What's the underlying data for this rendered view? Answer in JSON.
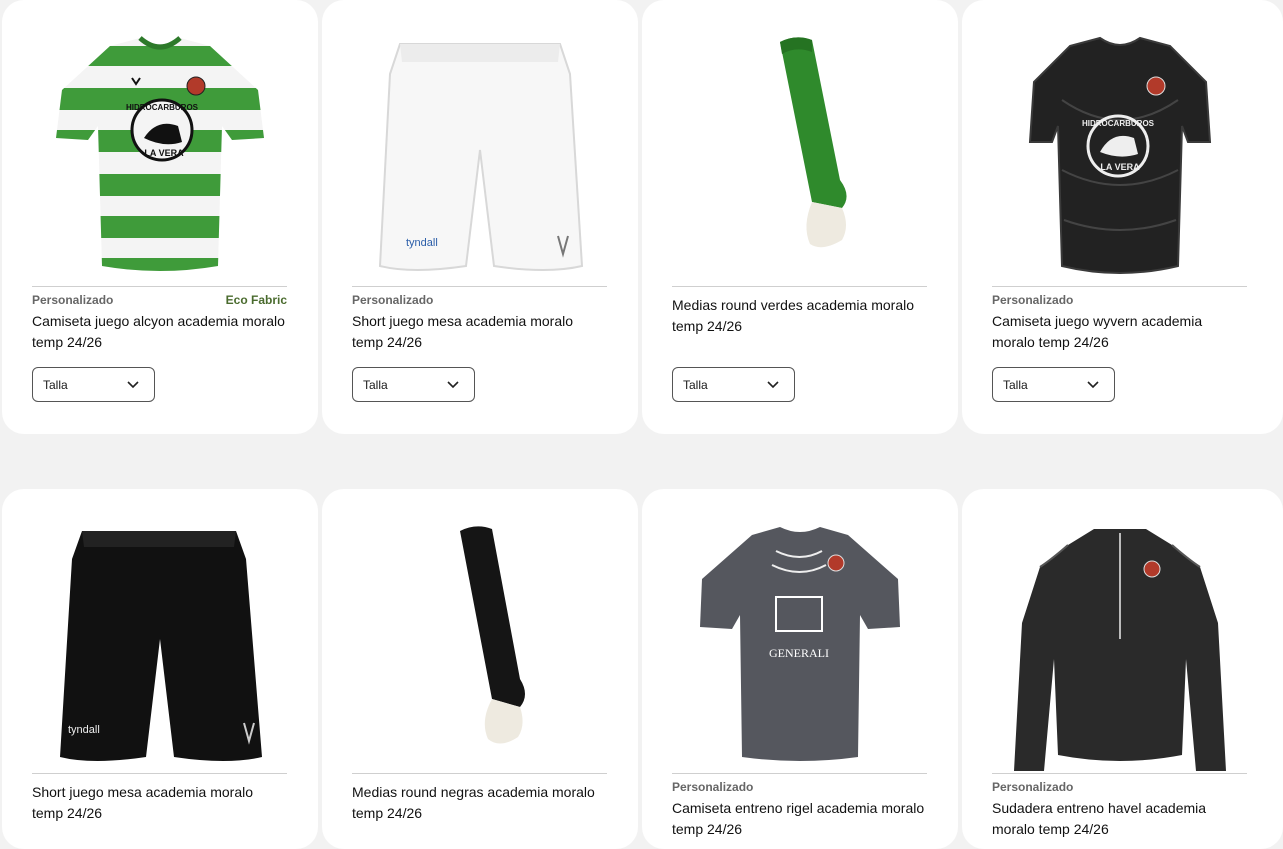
{
  "products": [
    {
      "tag": "Personalizado",
      "badge": "Eco Fabric",
      "title": "Camiseta juego alcyon academia moralo temp 24/26",
      "size_label": "Talla"
    },
    {
      "tag": "Personalizado",
      "badge": "",
      "title": "Short juego mesa academia moralo temp 24/26",
      "size_label": "Talla"
    },
    {
      "tag": "",
      "badge": "",
      "title": "Medias round verdes academia moralo temp 24/26",
      "size_label": "Talla"
    },
    {
      "tag": "Personalizado",
      "badge": "",
      "title": "Camiseta juego wyvern academia moralo temp 24/26",
      "size_label": "Talla"
    },
    {
      "tag": "",
      "badge": "",
      "title": "Short juego mesa academia moralo temp 24/26"
    },
    {
      "tag": "",
      "badge": "",
      "title": "Medias round negras academia moralo temp 24/26"
    },
    {
      "tag": "Personalizado",
      "badge": "",
      "title": "Camiseta entreno rigel academia moralo temp 24/26"
    },
    {
      "tag": "Personalizado",
      "badge": "",
      "title": "Sudadera entreno havel academia moralo temp 24/26"
    }
  ],
  "print_text": {
    "sponsor_arc": "HIDROCARBUROS",
    "sponsor_name": "LA VERA",
    "shorts_brand": "tyndall",
    "training_sponsor": "GENERALI"
  },
  "colors": {
    "green": "#3f9b3a",
    "jersey_black": "#1e1e1e",
    "jersey_grey": "#55575e",
    "eco": "#4a6b2e"
  }
}
